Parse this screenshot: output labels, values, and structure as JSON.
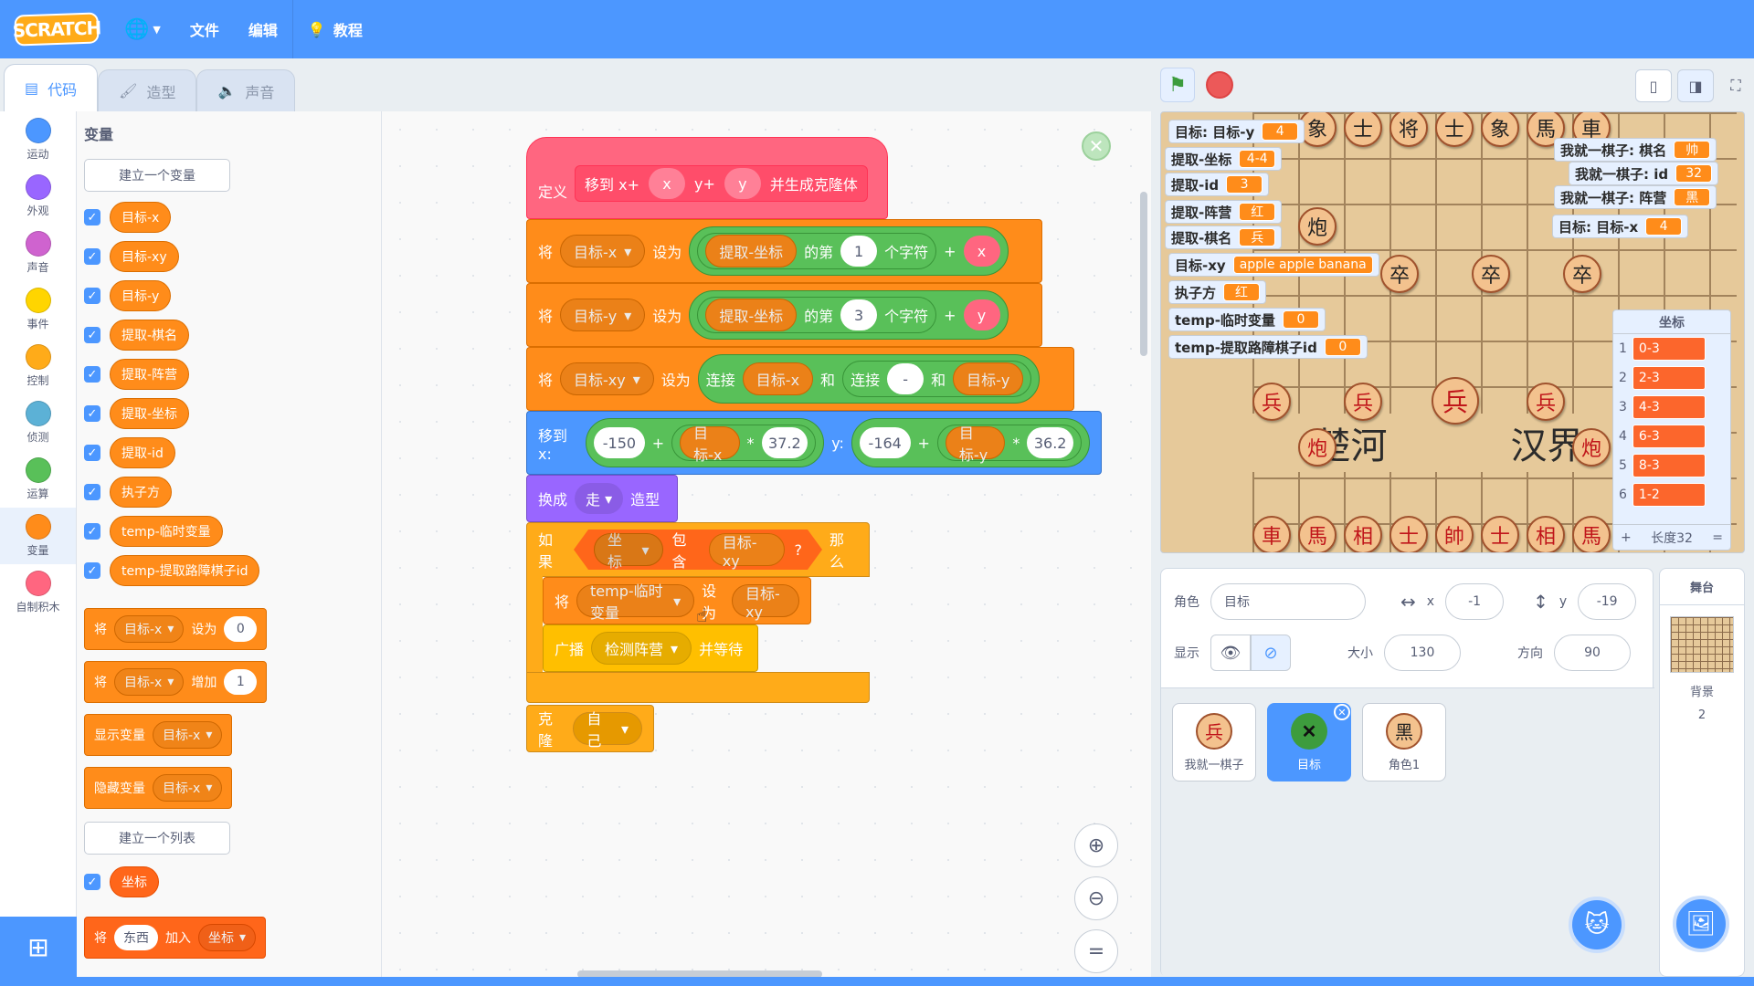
{
  "menubar": {
    "logo": "SCRATCH",
    "file": "文件",
    "edit": "编辑",
    "tutorial": "教程"
  },
  "tabs": {
    "code": "代码",
    "costumes": "造型",
    "sounds": "声音"
  },
  "categories": [
    {
      "label": "运动",
      "color": "#4c97ff"
    },
    {
      "label": "外观",
      "color": "#9966ff"
    },
    {
      "label": "声音",
      "color": "#cf63cf"
    },
    {
      "label": "事件",
      "color": "#ffd500"
    },
    {
      "label": "控制",
      "color": "#ffab19"
    },
    {
      "label": "侦测",
      "color": "#5cb1d6"
    },
    {
      "label": "运算",
      "color": "#59c059"
    },
    {
      "label": "变量",
      "color": "#ff8c1a"
    },
    {
      "label": "自制积木",
      "color": "#ff6680"
    }
  ],
  "palette": {
    "title": "变量",
    "make_variable": "建立一个变量",
    "variables": [
      "目标-x",
      "目标-xy",
      "目标-y",
      "提取-棋名",
      "提取-阵营",
      "提取-坐标",
      "提取-id",
      "执子方",
      "temp-临时变量",
      "temp-提取路障棋子id"
    ],
    "set_block": {
      "verb": "将",
      "var": "目标-x",
      "to": "设为",
      "value": "0"
    },
    "change_block": {
      "verb": "将",
      "var": "目标-x",
      "by": "增加",
      "value": "1"
    },
    "show_block": {
      "verb": "显示变量",
      "var": "目标-x"
    },
    "hide_block": {
      "verb": "隐藏变量",
      "var": "目标-x"
    },
    "make_list": "建立一个列表",
    "list_name": "坐标",
    "add_block": {
      "verb": "将",
      "value": "东西",
      "to": "加入",
      "list": "坐标"
    }
  },
  "code": {
    "define": {
      "kw": "定义",
      "name1": "移到 x+",
      "arg1": "x",
      "name2": "y+",
      "arg2": "y",
      "name3": "并生成克隆体"
    },
    "set1": {
      "verb": "将",
      "var": "目标-x",
      "to": "设为",
      "fn": "提取-坐标",
      "of": "的第",
      "n": "1",
      "ch": "个字符",
      "plus": "+",
      "arg": "x"
    },
    "set2": {
      "verb": "将",
      "var": "目标-y",
      "to": "设为",
      "fn": "提取-坐标",
      "of": "的第",
      "n": "3",
      "ch": "个字符",
      "plus": "+",
      "arg": "y"
    },
    "set3": {
      "verb": "将",
      "var": "目标-xy",
      "to": "设为",
      "join": "连接",
      "a": "目标-x",
      "and": "和",
      "join2": "连接",
      "sep": "-",
      "and2": "和",
      "b": "目标-y"
    },
    "goto": {
      "kw": "移到 x:",
      "x0": "-150",
      "plus": "+",
      "xv": "目标-x",
      "mul": "*",
      "xs": "37.2",
      "y": "y:",
      "y0": "-164",
      "plus2": "+",
      "yv": "目标-y",
      "mul2": "*",
      "ys": "36.2"
    },
    "costume": {
      "kw": "换成",
      "value": "走",
      "suffix": "造型"
    },
    "if": {
      "kw": "如果",
      "list": "坐标",
      "contains": "包含",
      "item": "目标-xy",
      "q": "?",
      "then": "那么"
    },
    "set4": {
      "verb": "将",
      "var": "temp-临时变量",
      "to": "设为",
      "value": "目标-xy"
    },
    "broadcast": {
      "kw": "广播",
      "msg": "检测阵营",
      "wait": "并等待"
    },
    "clone": {
      "kw": "克隆",
      "target": "自己"
    }
  },
  "stage": {
    "monitors_left": [
      {
        "label": "目标: 目标-y",
        "value": "4"
      },
      {
        "label": "提取-坐标",
        "value": "4-4"
      },
      {
        "label": "提取-id",
        "value": "3"
      },
      {
        "label": "提取-阵营",
        "value": "红"
      },
      {
        "label": "提取-棋名",
        "value": "兵"
      },
      {
        "label": "目标-xy",
        "value": "apple apple banana"
      },
      {
        "label": "执子方",
        "value": "红"
      },
      {
        "label": "temp-临时变量",
        "value": "0"
      },
      {
        "label": "temp-提取路障棋子id",
        "value": "0"
      }
    ],
    "monitors_right": [
      {
        "label": "我就一棋子: 棋名",
        "value": "帅"
      },
      {
        "label": "我就一棋子: id",
        "value": "32"
      },
      {
        "label": "我就一棋子: 阵营",
        "value": "黑"
      },
      {
        "label": "目标: 目标-x",
        "value": "4"
      }
    ],
    "river_left": "楚河",
    "river_right": "汉界",
    "list_monitor": {
      "title": "坐标",
      "items": [
        "0-3",
        "2-3",
        "4-3",
        "6-3",
        "8-3",
        "1-2"
      ],
      "indices": [
        "1",
        "2",
        "3",
        "4",
        "5",
        "6"
      ],
      "footer_plus": "+",
      "footer_len": "长度32",
      "footer_eq": "="
    },
    "pieces_top": [
      "象",
      "士",
      "将",
      "士",
      "象",
      "馬",
      "車"
    ],
    "pieces_bottom": [
      "車",
      "馬",
      "相",
      "士",
      "帥",
      "士",
      "相",
      "馬"
    ],
    "red_soldier": "兵",
    "red_cannon": "炮",
    "black_soldier": "卒",
    "black_cannon": "炮"
  },
  "sprite_info": {
    "sprite_label": "角色",
    "sprite_name": "目标",
    "x_label": "x",
    "x_value": "-1",
    "y_label": "y",
    "y_value": "-19",
    "show_label": "显示",
    "size_label": "大小",
    "size_value": "130",
    "direction_label": "方向",
    "direction_value": "90"
  },
  "sprites": [
    {
      "name": "我就一棋子",
      "glyph": "兵"
    },
    {
      "name": "目标",
      "glyph": "✕"
    },
    {
      "name": "角色1",
      "glyph": "黑"
    }
  ],
  "stage_pane": {
    "title": "舞台",
    "backdrop_label": "背景",
    "backdrop_count": "2"
  }
}
